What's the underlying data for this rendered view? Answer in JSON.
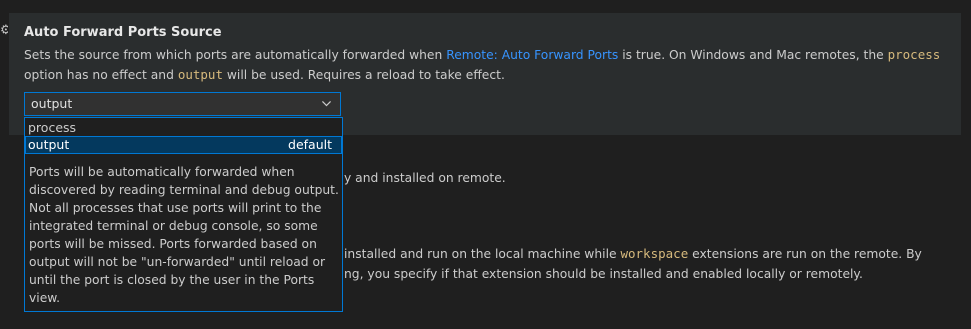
{
  "setting": {
    "title": "Auto Forward Ports Source",
    "desc_line1_a": "Sets the source from which ports are automatically forwarded when ",
    "desc_link": "Remote: Auto Forward Ports",
    "desc_line1_b": " is true. On Windows and Mac remotes, the ",
    "desc_code_process": "process",
    "desc_line2_a": "option has no effect and ",
    "desc_code_output": "output",
    "desc_line2_b": " will be used. Requires a reload to take effect."
  },
  "select": {
    "value": "output"
  },
  "dropdown": {
    "options": [
      {
        "label": "process"
      },
      {
        "label": "output",
        "badge": "default"
      }
    ],
    "description_lines": [
      "Ports will be automatically forwarded when",
      "discovered by reading terminal and debug output.",
      "Not all processes that use ports will print to the",
      "integrated terminal or debug console, so some",
      "ports will be missed. Ports forwarded based on",
      "output will not be \"un-forwarded\" until reload or",
      "until the port is closed by the user in the Ports",
      "view."
    ]
  },
  "background": {
    "line1": "y and installed on remote.",
    "line2_a": "installed and run on the local machine while ",
    "line2_code": "workspace",
    "line2_b": " extensions are run on the remote. By",
    "line3": "ng, you specify if that extension should be installed and enabled locally or remotely."
  },
  "icons": {
    "gear": "gear-icon",
    "chevron": "chevron-down-icon"
  },
  "colors": {
    "accent": "#0078d4",
    "link": "#3794ff",
    "code": "#d7ba7d",
    "selected_bg": "#04395e"
  }
}
